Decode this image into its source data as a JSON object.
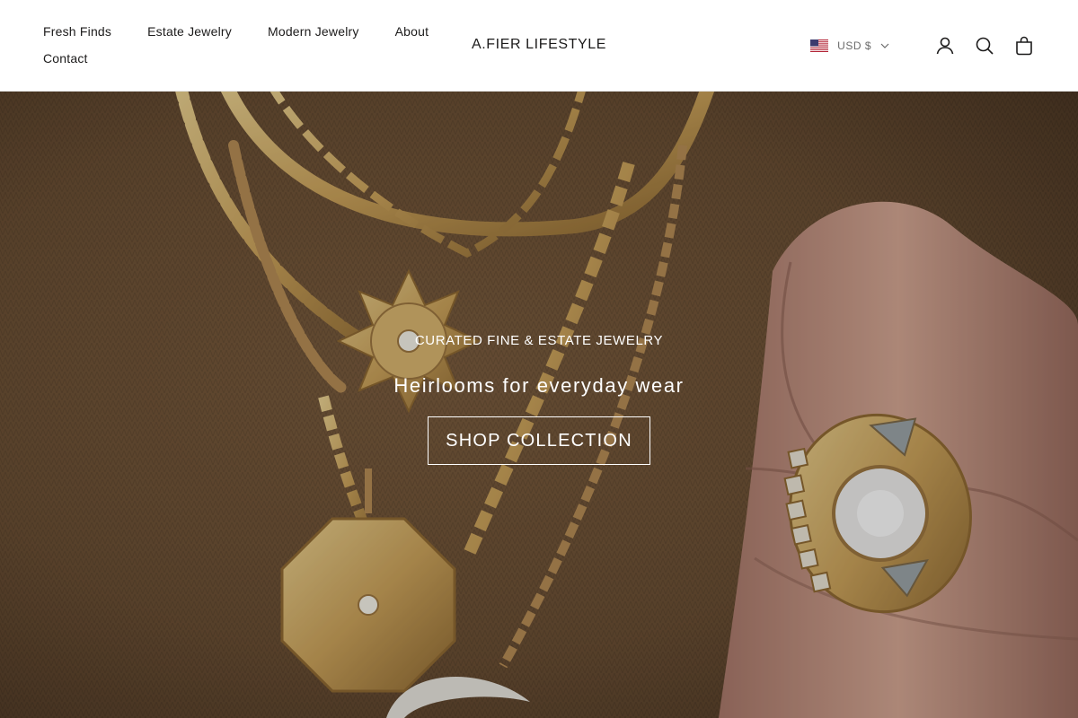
{
  "header": {
    "nav": [
      {
        "label": "Fresh Finds"
      },
      {
        "label": "Estate Jewelry"
      },
      {
        "label": "Modern Jewelry"
      },
      {
        "label": "About"
      },
      {
        "label": "Contact"
      }
    ],
    "brand": "A.FIER LIFESTYLE",
    "currency": {
      "label": "USD $",
      "flag_icon": "us-flag-icon"
    },
    "icons": [
      "account-icon",
      "search-icon",
      "cart-bag-icon"
    ]
  },
  "hero": {
    "kicker": "CURATED FINE & ESTATE JEWELRY",
    "headline": "Heirlooms for everyday wear",
    "cta_label": "SHOP COLLECTION"
  },
  "colors": {
    "text": "#1c1b1b",
    "muted": "#6b6b6b",
    "header_bg": "#ffffff",
    "hero_sweater": "#6e5236",
    "gold": "#c9a15a",
    "skin": "#c89a86",
    "overlay_text": "#ffffff"
  }
}
